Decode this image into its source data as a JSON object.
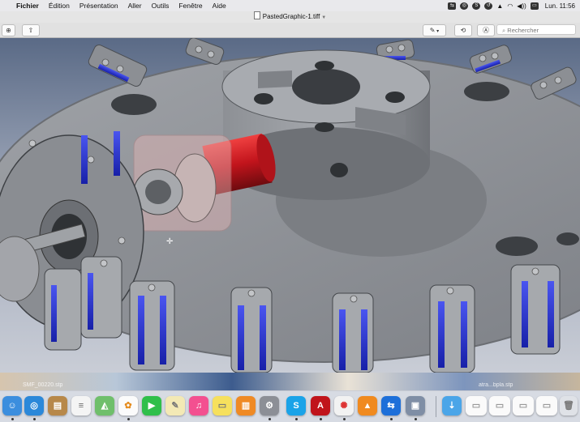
{
  "menubar": {
    "items": [
      "Fichier",
      "Édition",
      "Présentation",
      "Aller",
      "Outils",
      "Fenêtre",
      "Aide"
    ],
    "clock": "Lun. 11:56"
  },
  "window": {
    "title": "PastedGraphic-1.tiff",
    "search_placeholder": "Rechercher"
  },
  "desktop": {
    "labels": [
      "SMF_00220.stp",
      "atra...bpla.stp"
    ]
  },
  "dock": {
    "icons": [
      "finder",
      "safari",
      "contacts",
      "reminders",
      "maps",
      "photos",
      "facetime",
      "notes",
      "itunes",
      "stickies",
      "books",
      "system-preferences",
      "skype",
      "acrobat",
      "pinwheel",
      "vlc",
      "teamviewer",
      "preview",
      "downloads",
      "window-1",
      "window-2",
      "window-3",
      "window-4",
      "trash"
    ]
  },
  "colors": {
    "menubar": "#e9e9ec",
    "toolbar": "#e1e1e1",
    "background_blue": "#6a7790",
    "part_gray": "#8f9196",
    "accent_blue": "#2732d4",
    "accent_red": "#c2141c"
  }
}
